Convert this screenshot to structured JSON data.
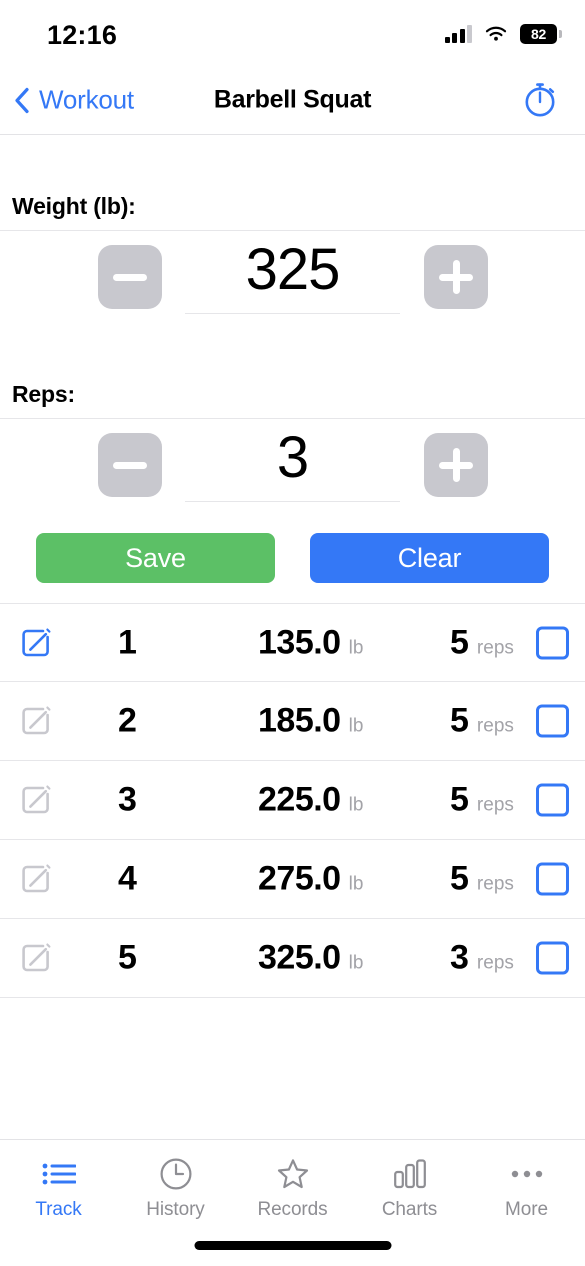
{
  "status_bar": {
    "time": "12:16",
    "battery_percent": "82",
    "signal_icon": "cellular-bars-icon",
    "wifi_icon": "wifi-icon",
    "battery_icon": "battery-icon"
  },
  "nav_bar": {
    "back_label": "Workout",
    "back_icon": "chevron-left-icon",
    "title": "Barbell Squat",
    "timer_icon": "stopwatch-icon"
  },
  "form": {
    "weight": {
      "label": "Weight (lb):",
      "value": "325",
      "decrement_label": "−",
      "increment_label": "+"
    },
    "reps": {
      "label": "Reps:",
      "value": "3",
      "decrement_label": "−",
      "increment_label": "+"
    }
  },
  "actions": {
    "save_label": "Save",
    "clear_label": "Clear",
    "save_color": "#5cc066",
    "clear_color": "#3478f6"
  },
  "set_list": {
    "weight_unit": "lb",
    "reps_unit": "reps",
    "rows": [
      {
        "index": "1",
        "weight": "135.0",
        "unit": "lb",
        "reps": "5",
        "reps_unit": "reps",
        "edit_icon": "edit-square-pencil-icon",
        "edit_active": true,
        "checked": false
      },
      {
        "index": "2",
        "weight": "185.0",
        "unit": "lb",
        "reps": "5",
        "reps_unit": "reps",
        "edit_icon": "edit-square-pencil-icon",
        "edit_active": false,
        "checked": false
      },
      {
        "index": "3",
        "weight": "225.0",
        "unit": "lb",
        "reps": "5",
        "reps_unit": "reps",
        "edit_icon": "edit-square-pencil-icon",
        "edit_active": false,
        "checked": false
      },
      {
        "index": "4",
        "weight": "275.0",
        "unit": "lb",
        "reps": "5",
        "reps_unit": "reps",
        "edit_icon": "edit-square-pencil-icon",
        "edit_active": false,
        "checked": false
      },
      {
        "index": "5",
        "weight": "325.0",
        "unit": "lb",
        "reps": "3",
        "reps_unit": "reps",
        "edit_icon": "edit-square-pencil-icon",
        "edit_active": false,
        "checked": false
      }
    ]
  },
  "tab_bar": {
    "active_color": "#3478f6",
    "inactive_color": "#8e8e93",
    "tabs": [
      {
        "label": "Track",
        "icon": "bulleted-list-icon",
        "active": true
      },
      {
        "label": "History",
        "icon": "clock-icon",
        "active": false
      },
      {
        "label": "Records",
        "icon": "star-icon",
        "active": false
      },
      {
        "label": "Charts",
        "icon": "bar-chart-icon",
        "active": false
      },
      {
        "label": "More",
        "icon": "ellipsis-icon",
        "active": false
      }
    ]
  }
}
